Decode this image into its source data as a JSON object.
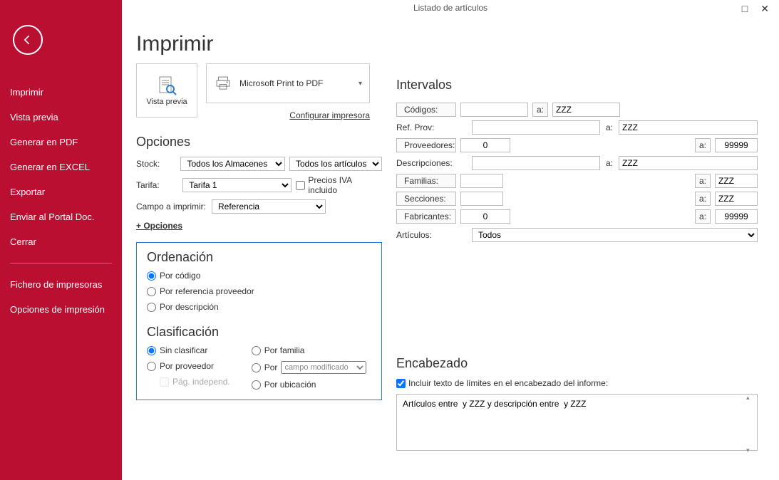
{
  "window": {
    "title": "Listado de artículos"
  },
  "sidebar": {
    "items": [
      "Imprimir",
      "Vista previa",
      "Generar en PDF",
      "Generar en EXCEL",
      "Exportar",
      "Enviar al Portal Doc.",
      "Cerrar"
    ],
    "items2": [
      "Fichero de impresoras",
      "Opciones de impresión"
    ]
  },
  "page": {
    "title": "Imprimir",
    "vista_previa": "Vista previa",
    "printer_name": "Microsoft Print to PDF",
    "config_printer": "Configurar impresora"
  },
  "opciones": {
    "heading": "Opciones",
    "stock_label": "Stock:",
    "stock_value": "Todos los Almacenes",
    "stock_filter": "Todos los artículos",
    "tarifa_label": "Tarifa:",
    "tarifa_value": "Tarifa 1",
    "precios_iva": "Precios IVA incluido",
    "campo_label": "Campo a imprimir:",
    "campo_value": "Referencia",
    "mas_opciones": "+ Opciones"
  },
  "ordenacion": {
    "heading": "Ordenación",
    "por_codigo": "Por código",
    "por_ref": "Por referencia proveedor",
    "por_desc": "Por descripción"
  },
  "clasificacion": {
    "heading": "Clasificación",
    "sin": "Sin clasificar",
    "proveedor": "Por proveedor",
    "pag": "Pág. independ.",
    "familia": "Por familia",
    "por": "Por",
    "campo_mod": "campo modificado",
    "ubicacion": "Por ubicación"
  },
  "intervalos": {
    "heading": "Intervalos",
    "codigos": "Códigos:",
    "ref_prov": "Ref. Prov:",
    "proveedores": "Proveedores:",
    "descripciones": "Descripciones:",
    "familias": "Familias:",
    "secciones": "Secciones:",
    "fabricantes": "Fabricantes:",
    "articulos": "Artículos:",
    "a": "a:",
    "zzz": "ZZZ",
    "zero": "0",
    "max_num": "99999",
    "todos": "Todos"
  },
  "encabezado": {
    "heading": "Encabezado",
    "check_label": "Incluir texto de límites en el encabezado del informe:",
    "text": "Artículos entre  y ZZZ y descripción entre  y ZZZ"
  }
}
